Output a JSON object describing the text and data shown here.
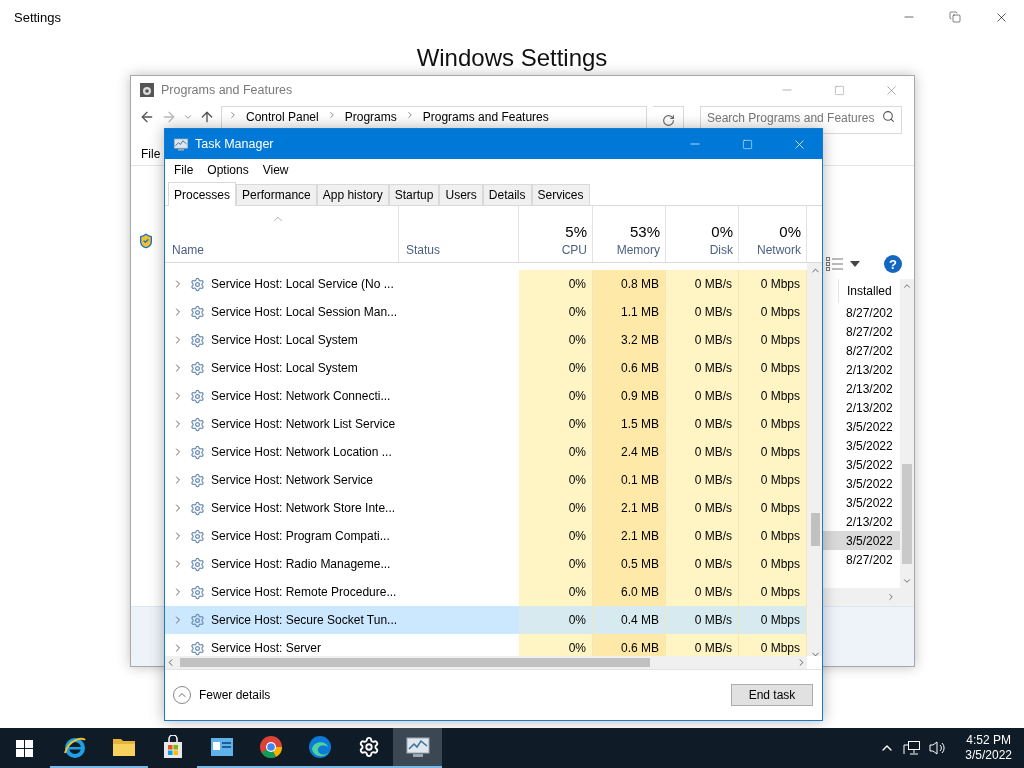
{
  "settings": {
    "title": "Settings",
    "heading": "Windows Settings"
  },
  "programs_window": {
    "title": "Programs and Features",
    "breadcrumb": [
      "Control Panel",
      "Programs",
      "Programs and Features"
    ],
    "search": {
      "placeholder": "Search Programs and Features"
    },
    "menu": [
      "File"
    ],
    "help": "?",
    "column": "Installed",
    "dates": [
      {
        "text": "8/27/202",
        "selected": false
      },
      {
        "text": "8/27/202",
        "selected": false
      },
      {
        "text": "8/27/202",
        "selected": false
      },
      {
        "text": "2/13/202",
        "selected": false
      },
      {
        "text": "2/13/202",
        "selected": false
      },
      {
        "text": "2/13/202",
        "selected": false
      },
      {
        "text": "3/5/2022",
        "selected": false
      },
      {
        "text": "3/5/2022",
        "selected": false
      },
      {
        "text": "3/5/2022",
        "selected": false
      },
      {
        "text": "3/5/2022",
        "selected": false
      },
      {
        "text": "3/5/2022",
        "selected": false
      },
      {
        "text": "2/13/202",
        "selected": false
      },
      {
        "text": "3/5/2022",
        "selected": true
      },
      {
        "text": "8/27/202",
        "selected": false
      }
    ]
  },
  "task_manager": {
    "title": "Task Manager",
    "menu": [
      "File",
      "Options",
      "View"
    ],
    "tabs": [
      {
        "label": "Processes",
        "selected": true
      },
      {
        "label": "Performance",
        "selected": false
      },
      {
        "label": "App history",
        "selected": false
      },
      {
        "label": "Startup",
        "selected": false
      },
      {
        "label": "Users",
        "selected": false
      },
      {
        "label": "Details",
        "selected": false
      },
      {
        "label": "Services",
        "selected": false
      }
    ],
    "columns": [
      {
        "label": "Name"
      },
      {
        "label": "Status"
      },
      {
        "percent": "5%",
        "label": "CPU"
      },
      {
        "percent": "53%",
        "label": "Memory"
      },
      {
        "percent": "0%",
        "label": "Disk"
      },
      {
        "percent": "0%",
        "label": "Network"
      }
    ],
    "rows": [
      {
        "name": "Service Host: Local Service (No ...",
        "cpu": "0%",
        "memory": "0.8 MB",
        "disk": "0 MB/s",
        "network": "0 Mbps",
        "selected": false
      },
      {
        "name": "Service Host: Local Session Man...",
        "cpu": "0%",
        "memory": "1.1 MB",
        "disk": "0 MB/s",
        "network": "0 Mbps",
        "selected": false
      },
      {
        "name": "Service Host: Local System",
        "cpu": "0%",
        "memory": "3.2 MB",
        "disk": "0 MB/s",
        "network": "0 Mbps",
        "selected": false
      },
      {
        "name": "Service Host: Local System",
        "cpu": "0%",
        "memory": "0.6 MB",
        "disk": "0 MB/s",
        "network": "0 Mbps",
        "selected": false
      },
      {
        "name": "Service Host: Network Connecti...",
        "cpu": "0%",
        "memory": "0.9 MB",
        "disk": "0 MB/s",
        "network": "0 Mbps",
        "selected": false
      },
      {
        "name": "Service Host: Network List Service",
        "cpu": "0%",
        "memory": "1.5 MB",
        "disk": "0 MB/s",
        "network": "0 Mbps",
        "selected": false
      },
      {
        "name": "Service Host: Network Location ...",
        "cpu": "0%",
        "memory": "2.4 MB",
        "disk": "0 MB/s",
        "network": "0 Mbps",
        "selected": false
      },
      {
        "name": "Service Host: Network Service",
        "cpu": "0%",
        "memory": "0.1 MB",
        "disk": "0 MB/s",
        "network": "0 Mbps",
        "selected": false
      },
      {
        "name": "Service Host: Network Store Inte...",
        "cpu": "0%",
        "memory": "2.1 MB",
        "disk": "0 MB/s",
        "network": "0 Mbps",
        "selected": false
      },
      {
        "name": "Service Host: Program Compati...",
        "cpu": "0%",
        "memory": "2.1 MB",
        "disk": "0 MB/s",
        "network": "0 Mbps",
        "selected": false
      },
      {
        "name": "Service Host: Radio Manageme...",
        "cpu": "0%",
        "memory": "0.5 MB",
        "disk": "0 MB/s",
        "network": "0 Mbps",
        "selected": false
      },
      {
        "name": "Service Host: Remote Procedure...",
        "cpu": "0%",
        "memory": "6.0 MB",
        "disk": "0 MB/s",
        "network": "0 Mbps",
        "selected": false
      },
      {
        "name": "Service Host: Secure Socket Tun...",
        "cpu": "0%",
        "memory": "0.4 MB",
        "disk": "0 MB/s",
        "network": "0 Mbps",
        "selected": true
      },
      {
        "name": "Service Host: Server",
        "cpu": "0%",
        "memory": "0.6 MB",
        "disk": "0 MB/s",
        "network": "0 Mbps",
        "selected": false
      }
    ],
    "fewer_details": "Fewer details",
    "end_task": "End task"
  },
  "taskbar": {
    "apps": [
      {
        "kind": "ie",
        "running": true,
        "active": false
      },
      {
        "kind": "explorer",
        "running": true,
        "active": false
      },
      {
        "kind": "store",
        "running": false,
        "active": false
      },
      {
        "kind": "app",
        "running": true,
        "active": false
      },
      {
        "kind": "chrome",
        "running": true,
        "active": false
      },
      {
        "kind": "edge",
        "running": true,
        "active": false
      },
      {
        "kind": "settings",
        "running": true,
        "active": false
      },
      {
        "kind": "taskmanager",
        "running": true,
        "active": true
      }
    ],
    "clock": {
      "time": "4:52 PM",
      "date": "3/5/2022"
    }
  }
}
